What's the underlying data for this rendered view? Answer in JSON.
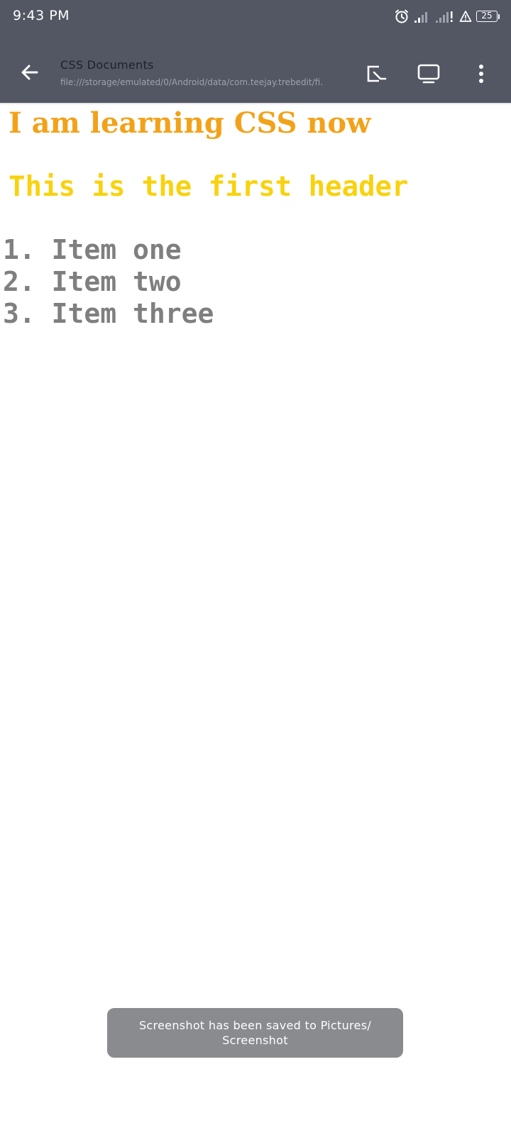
{
  "status_bar": {
    "time": "9:43 PM",
    "battery": "25",
    "icons": [
      "alarm-icon",
      "signal-icon",
      "signal-icon",
      "data-saver-icon",
      "battery-icon"
    ]
  },
  "app_bar": {
    "title": "CSS Documents",
    "url": "file:///storage/emulated/0/Android/data/com.teejay.trebedit/fi...",
    "actions": [
      "open-external-icon",
      "desktop-view-icon",
      "more-options-icon"
    ]
  },
  "page": {
    "heading": "I am learning CSS now",
    "subheading": "This is the first header",
    "items": [
      "1. Item one",
      "2. Item two",
      "3. Item three"
    ]
  },
  "toast": {
    "message": "Screenshot has been saved to  Pictures/ Screenshot"
  },
  "colors": {
    "topbar": "#535764",
    "heading": "#f2a21a",
    "subheading": "#f8d20e",
    "list": "#7f7f7f",
    "toast": "#8a8b8f"
  }
}
